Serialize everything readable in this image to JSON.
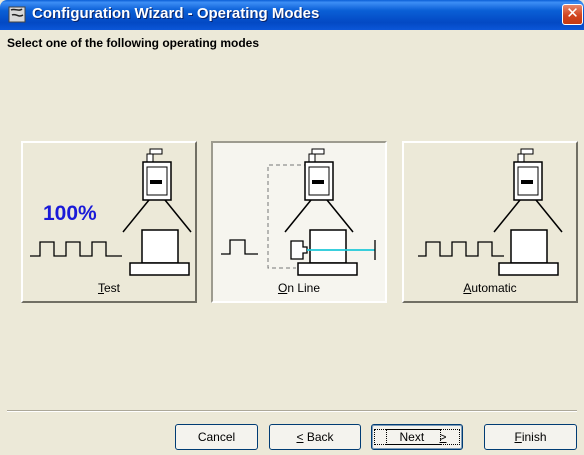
{
  "window": {
    "title": "Configuration Wizard - Operating Modes",
    "icon": "wizard-icon",
    "close_icon": "close-icon"
  },
  "header": {
    "instruction": "Select one of the following operating modes"
  },
  "modes": [
    {
      "label": "Test",
      "accel": "T",
      "rest": "est",
      "badge": "100%",
      "selected": false
    },
    {
      "label": "On Line",
      "accel": "O",
      "rest": "n Line",
      "selected": true
    },
    {
      "label": "Automatic",
      "accel": "A",
      "rest": "utomatic",
      "selected": false
    }
  ],
  "buttons": {
    "cancel": "Cancel",
    "back_accel": "<",
    "back_rest": " Back",
    "back_prefix_accel": "",
    "next_pre": "Next ",
    "next_accel": ">",
    "finish_accel": "F",
    "finish_rest": "inish"
  },
  "colors": {
    "titlebar": "#0a5fd6",
    "accent_text": "#1a1ad8",
    "beam": "#1ec8d8",
    "close": "#d1441f"
  }
}
